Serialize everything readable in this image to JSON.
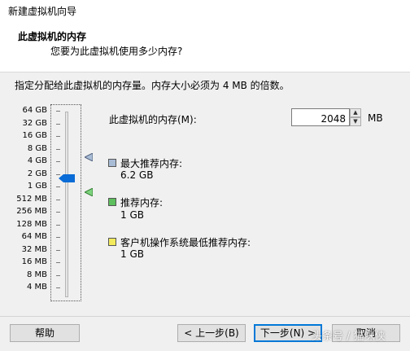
{
  "window": {
    "title": "新建虚拟机向导"
  },
  "header": {
    "title": "此虚拟机的内存",
    "subtitle": "您要为此虚拟机使用多少内存?"
  },
  "instruction": "指定分配给此虚拟机的内存量。内存大小必须为 4 MB 的倍数。",
  "slider": {
    "labels": [
      "64 GB",
      "32 GB",
      "16 GB",
      "8 GB",
      "4 GB",
      "2 GB",
      "1 GB",
      "512 MB",
      "256 MB",
      "128 MB",
      "64 MB",
      "32 MB",
      "16 MB",
      "8 MB",
      "4 MB"
    ],
    "selected": "2 GB"
  },
  "memory": {
    "label": "此虚拟机的内存(M):",
    "value": "2048",
    "unit": "MB"
  },
  "legend": [
    {
      "title": "最大推荐内存:",
      "value": "6.2 GB",
      "color": "#a9bcd6"
    },
    {
      "title": "推荐内存:",
      "value": "1 GB",
      "color": "#5dbf5d"
    },
    {
      "title": "客户机操作系统最低推荐内存:",
      "value": "1 GB",
      "color": "#f2ea5c"
    }
  ],
  "markers": {
    "max_color": "#a9bcd6",
    "recommended_color": "#7dd37d"
  },
  "buttons": {
    "help": "帮助",
    "back": "< 上一步(B)",
    "next": "下一步(N) >",
    "cancel": "取消"
  },
  "watermark": "头条号 / 猫咪侠"
}
